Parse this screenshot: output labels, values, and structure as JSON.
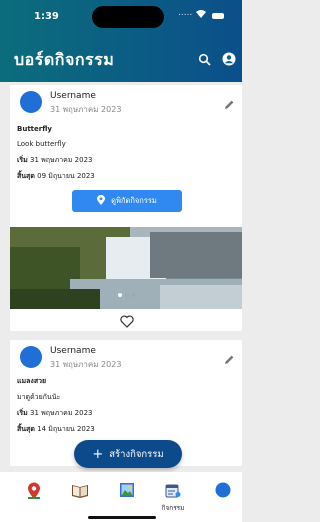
{
  "status": {
    "time": "1:39",
    "signal": "....."
  },
  "header": {
    "title": "บอร์ดกิจกรรม"
  },
  "posts": [
    {
      "username": "Username",
      "posted_date": "31 พฤษภาคม 2023",
      "title": "Butterfly",
      "description": "Look butterfly",
      "start_label": "เริ่ม",
      "start_date": "31 พฤษภาคม 2023",
      "end_label": "สิ้นสุด",
      "end_date": "09 มิถุนายน 2023",
      "locate_label": "ดูพิกัดกิจกรรม"
    },
    {
      "username": "Username",
      "posted_date": "31 พฤษภาคม 2023",
      "title": "แมลงสวย",
      "description": "มาดูด้วยกันนัะ",
      "start_label": "เริ่ม",
      "start_date": "31 พฤษภาคม 2023",
      "end_label": "สิ้นสุด",
      "end_date": "14 มิถุนายน 2023"
    }
  ],
  "fab": {
    "label": "สร้างกิจกรรม"
  },
  "bottom_nav": [
    {
      "icon": "map-pin-icon",
      "label": ""
    },
    {
      "icon": "book-icon",
      "label": ""
    },
    {
      "icon": "picture-icon",
      "label": ""
    },
    {
      "icon": "activity-board-icon",
      "label": "กิจกรรม"
    },
    {
      "icon": "profile-icon",
      "label": ""
    }
  ],
  "colors": {
    "header": "#0b5f85",
    "accent": "#2f89f0",
    "fab": "#0d4a8c"
  }
}
